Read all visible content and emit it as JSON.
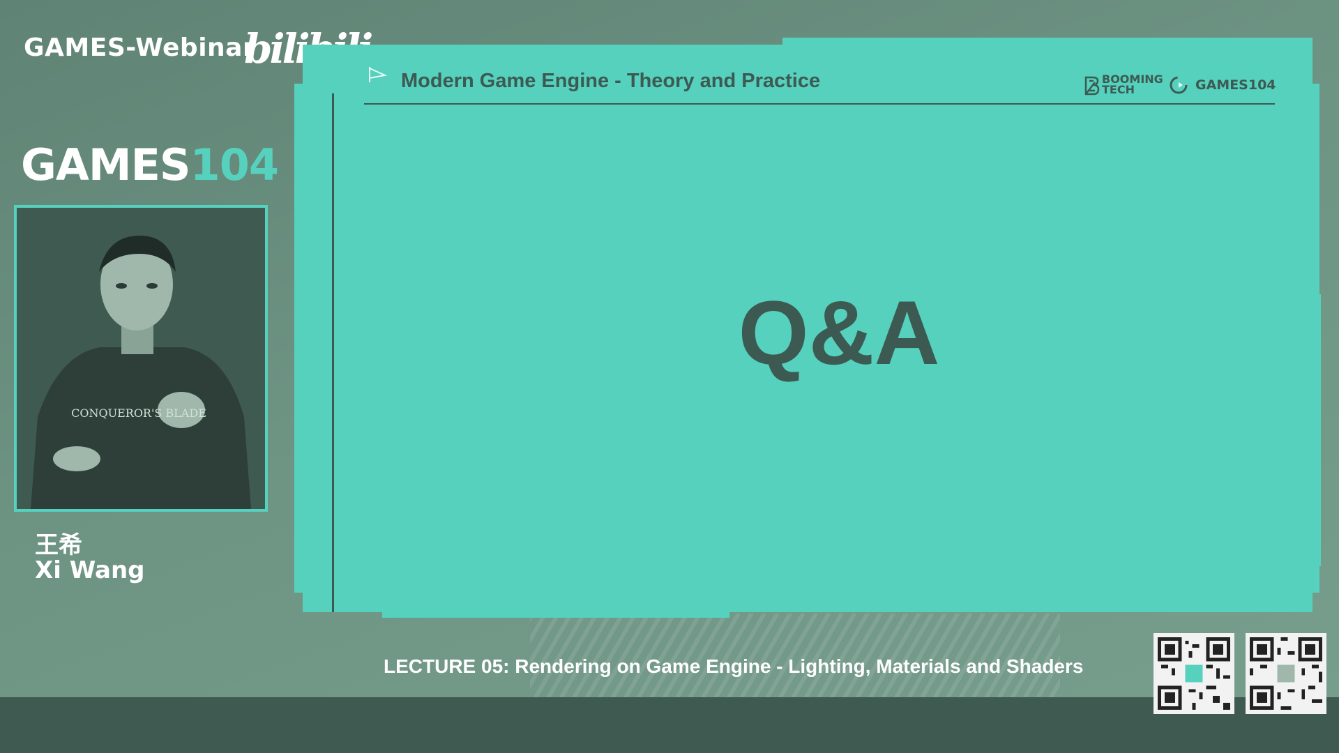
{
  "header": {
    "webinar_title": "GAMES-Webinar",
    "platform_logo": "bilibili",
    "course_logo_part1": "GAMES",
    "course_logo_part2": "104"
  },
  "speaker": {
    "name_cn": "王希",
    "name_en": "Xi Wang",
    "shirt_text": "CONQUEROR'S BLADE"
  },
  "slide": {
    "header_title": "Modern Game Engine - Theory and Practice",
    "sponsor_logo": "BOOMING TECH",
    "course_logo": "GAMES104",
    "main_text": "Q&A"
  },
  "footer": {
    "lecture_title": "LECTURE 05: Rendering on Game Engine - Lighting, Materials and Shaders"
  },
  "colors": {
    "accent": "#55d1be",
    "dark": "#3d5a52",
    "background": "#6f9384",
    "bottom_bar": "#3f5a51"
  },
  "icons": [
    "arrow-flag-icon",
    "booming-tech-logo",
    "games-mini-icon",
    "qr-code-icon"
  ]
}
